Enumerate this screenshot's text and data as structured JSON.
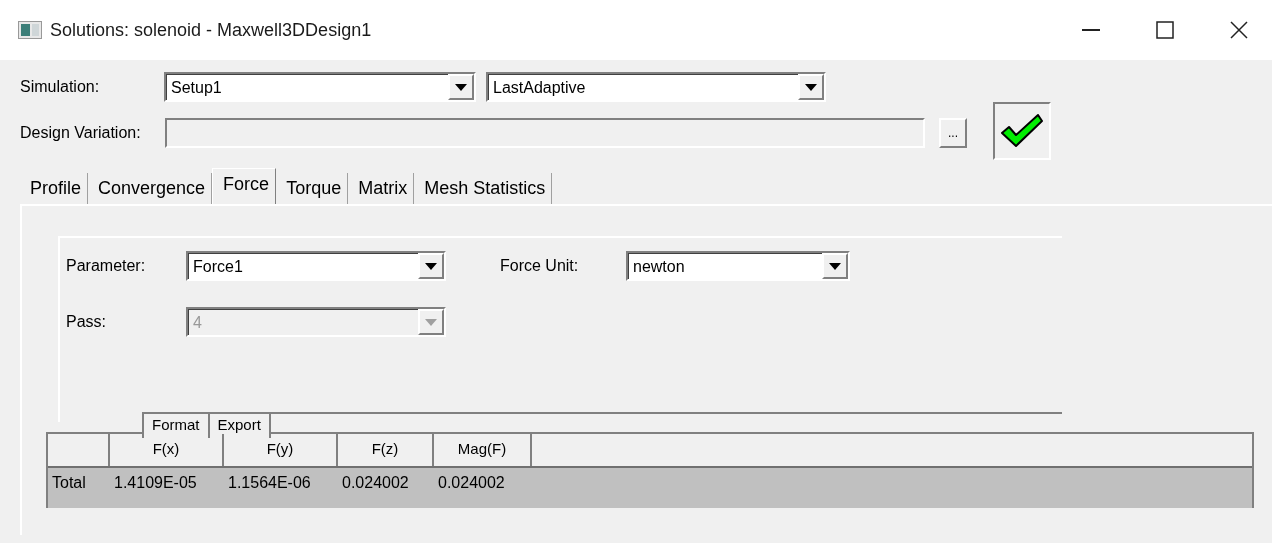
{
  "window": {
    "title": "Solutions: solenoid - Maxwell3DDesign1"
  },
  "simulation": {
    "label": "Simulation:",
    "setup": "Setup1",
    "solution": "LastAdaptive"
  },
  "design_variation": {
    "label": "Design Variation:",
    "browse_button": "...",
    "valid": true
  },
  "tabs": [
    {
      "label": "Profile",
      "selected": false
    },
    {
      "label": "Convergence",
      "selected": false
    },
    {
      "label": "Force",
      "selected": true
    },
    {
      "label": "Torque",
      "selected": false
    },
    {
      "label": "Matrix",
      "selected": false
    },
    {
      "label": "Mesh Statistics",
      "selected": false
    }
  ],
  "force": {
    "parameter": {
      "label": "Parameter:",
      "value": "Force1",
      "disabled": false
    },
    "force_unit": {
      "label": "Force Unit:",
      "value": "newton",
      "disabled": false
    },
    "pass": {
      "label": "Pass:",
      "value": "4",
      "disabled": true
    },
    "view_tabs": [
      {
        "label": "Format"
      },
      {
        "label": "Export"
      }
    ]
  },
  "table": {
    "columns": [
      "F(x)",
      "F(y)",
      "F(z)",
      "Mag(F)"
    ],
    "rows": [
      {
        "label": "Total",
        "cells": [
          "1.4109E-05",
          "1.1564E-06",
          "0.024002",
          "0.024002"
        ],
        "selected": true
      }
    ]
  }
}
